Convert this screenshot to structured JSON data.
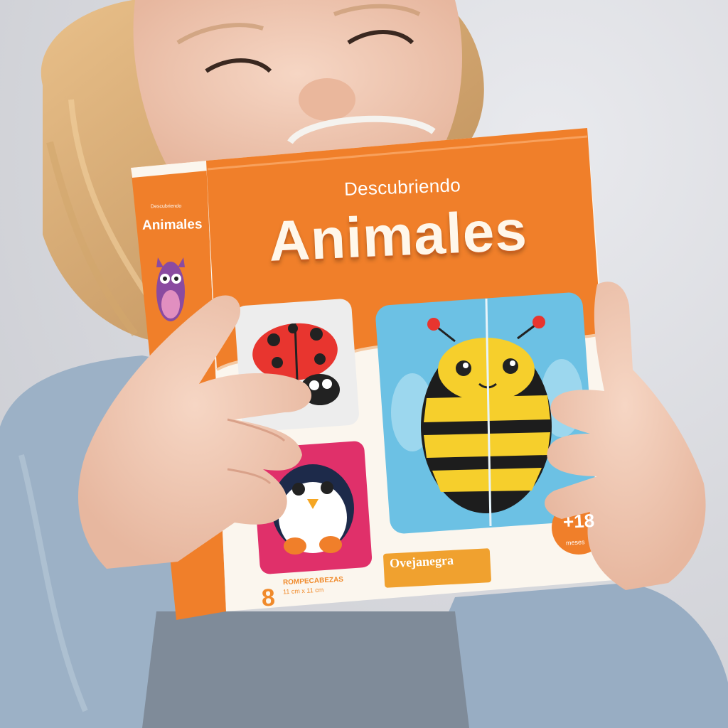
{
  "box": {
    "subtitle": "Descubriendo",
    "title": "Animales",
    "side_subtitle": "Descubriendo",
    "side_title": "Animales",
    "piece_count": "8",
    "piece_label": "ROMPECABEZAS",
    "piece_size": "11 cm x 11 cm",
    "brand": "Ovejanegra",
    "age": "+18",
    "age_unit": "meses"
  },
  "colors": {
    "box_orange": "#f07f2a",
    "box_cream": "#fbf6ee",
    "ladybug_red": "#e8352f",
    "bee_yellow": "#f6cf2c",
    "sky_blue": "#6cc1e4",
    "penguin_pink": "#e0306a",
    "sweater_blue": "#9cb1c6"
  },
  "icons": [
    "owl-icon",
    "ladybug-icon",
    "bee-icon",
    "penguin-icon"
  ]
}
